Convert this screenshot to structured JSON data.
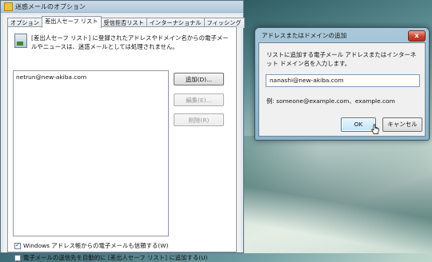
{
  "main_window": {
    "title": "迷惑メールのオプション",
    "tabs": [
      "オプション",
      "差出人セーフ リスト",
      "受信拒否リスト",
      "インターナショナル",
      "フィッシング"
    ],
    "active_tab_index": 1,
    "description": "[差出人セーフ リスト] に登録されたアドレスやドメイン名からの電子メールやニュースは、迷惑メールとしては処理されません。",
    "list_items": [
      "netrun@new-akiba.com"
    ],
    "buttons": {
      "add": "追加(D)...",
      "edit": "編集(E)...",
      "remove": "削除(R)"
    },
    "checkbox_trust_contacts": {
      "label": "Windows アドレス帳からの電子メールも信頼する(W)",
      "checked": true
    },
    "checkbox_auto_add": {
      "label": "電子メールの送信先を自動的に [差出人セーフ リスト] に追加する(U)",
      "checked": false
    }
  },
  "dialog": {
    "title": "アドレスまたはドメインの追加",
    "prompt": "リストに追加する電子メール アドレスまたはインターネット ドメイン名を入力します。",
    "input_value": "nanashi@new-akiba.com",
    "example": "例: someone@example.com、example.com",
    "ok_label": "OK",
    "cancel_label": "キャンセル",
    "close_glyph": "x"
  },
  "icons": {
    "title_icon": "mail-options-icon",
    "description_icon": "safe-sender-icon",
    "close_icon": "close-icon",
    "cursor_icon": "hand-cursor-icon"
  }
}
